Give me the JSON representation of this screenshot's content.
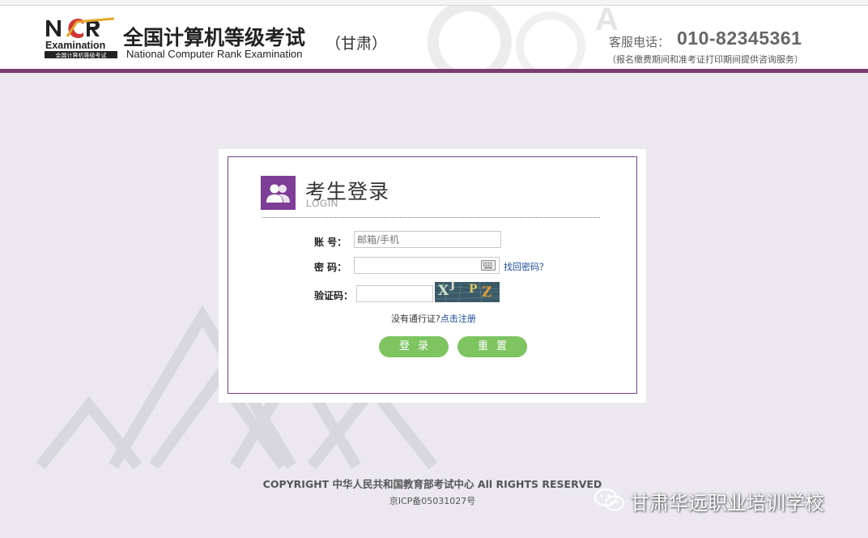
{
  "header": {
    "logo_letters": "NCR",
    "logo_word": "Examination",
    "logo_strip": "全国计算机等级考试",
    "title": "全国计算机等级考试",
    "subtitle": "National Computer Rank Examination",
    "province": "（甘肃）",
    "phone_label": "客服电话：",
    "phone_number": "010-82345361",
    "phone_note": "（报名缴费期间和准考证打印期间提供咨询服务）"
  },
  "login": {
    "title": "考生登录",
    "subtitle": "LOGIN",
    "account_label": "账    号：",
    "account_placeholder": "邮箱/手机",
    "password_label": "密    码：",
    "forgot_password": "找回密码？",
    "captcha_label": "验证码：",
    "captcha_text": [
      "X",
      "J",
      "P",
      "Z"
    ],
    "register_prompt": "没有通行证?",
    "register_link": "点击注册",
    "login_button": "登录",
    "reset_button": "重置"
  },
  "footer": {
    "copyright": "COPYRIGHT 中华人民共和国教育部考试中心 All RIGHTS RESERVED",
    "icp": "京ICP备05031027号"
  },
  "watermark": {
    "text": "甘肃华远职业培训学校"
  },
  "colors": {
    "accent_purple": "#7b3d6e",
    "button_green": "#7ec461",
    "link_blue": "#1a4b9c"
  }
}
